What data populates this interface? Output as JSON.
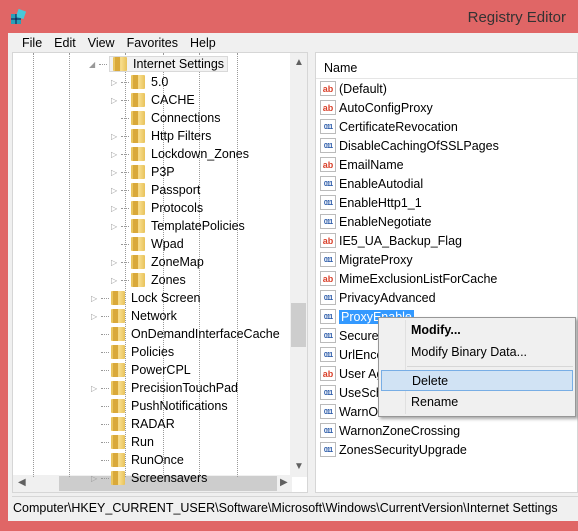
{
  "window": {
    "title": "Registry Editor",
    "icon": "registry-editor-icon",
    "border_color": "#e06666"
  },
  "menu": [
    "File",
    "Edit",
    "View",
    "Favorites",
    "Help"
  ],
  "tree": {
    "selected": "Internet Settings",
    "children": [
      {
        "label": "5.0",
        "expandable": true
      },
      {
        "label": "CACHE",
        "expandable": true
      },
      {
        "label": "Connections",
        "expandable": false
      },
      {
        "label": "Http Filters",
        "expandable": true
      },
      {
        "label": "Lockdown_Zones",
        "expandable": true
      },
      {
        "label": "P3P",
        "expandable": true
      },
      {
        "label": "Passport",
        "expandable": true
      },
      {
        "label": "Protocols",
        "expandable": true
      },
      {
        "label": "TemplatePolicies",
        "expandable": true
      },
      {
        "label": "Wpad",
        "expandable": false
      },
      {
        "label": "ZoneMap",
        "expandable": true
      },
      {
        "label": "Zones",
        "expandable": true
      }
    ],
    "siblings": [
      {
        "label": "Lock Screen",
        "expandable": true
      },
      {
        "label": "Network",
        "expandable": true
      },
      {
        "label": "OnDemandInterfaceCache",
        "expandable": false
      },
      {
        "label": "Policies",
        "expandable": false
      },
      {
        "label": "PowerCPL",
        "expandable": false
      },
      {
        "label": "PrecisionTouchPad",
        "expandable": true
      },
      {
        "label": "PushNotifications",
        "expandable": false
      },
      {
        "label": "RADAR",
        "expandable": false
      },
      {
        "label": "Run",
        "expandable": false
      },
      {
        "label": "RunOnce",
        "expandable": false
      },
      {
        "label": "Screensavers",
        "expandable": true
      }
    ]
  },
  "list": {
    "header": "Name",
    "items": [
      {
        "name": "(Default)",
        "type": "sz"
      },
      {
        "name": "AutoConfigProxy",
        "type": "sz"
      },
      {
        "name": "CertificateRevocation",
        "type": "bin"
      },
      {
        "name": "DisableCachingOfSSLPages",
        "type": "bin"
      },
      {
        "name": "EmailName",
        "type": "sz"
      },
      {
        "name": "EnableAutodial",
        "type": "bin"
      },
      {
        "name": "EnableHttp1_1",
        "type": "bin"
      },
      {
        "name": "EnableNegotiate",
        "type": "bin"
      },
      {
        "name": "IE5_UA_Backup_Flag",
        "type": "sz"
      },
      {
        "name": "MigrateProxy",
        "type": "bin"
      },
      {
        "name": "MimeExclusionListForCache",
        "type": "sz"
      },
      {
        "name": "PrivacyAdvanced",
        "type": "bin"
      },
      {
        "name": "ProxyEnable",
        "type": "bin",
        "selected": true
      },
      {
        "name": "SecureProtocols",
        "type": "bin"
      },
      {
        "name": "UrlEncoding",
        "type": "bin"
      },
      {
        "name": "User Agent",
        "type": "sz"
      },
      {
        "name": "UseSchannelDirectly",
        "type": "bin"
      },
      {
        "name": "WarnOnIntranet",
        "type": "bin"
      },
      {
        "name": "WarnonZoneCrossing",
        "type": "bin"
      },
      {
        "name": "ZonesSecurityUpgrade",
        "type": "bin"
      }
    ]
  },
  "context_menu": {
    "items": [
      {
        "label": "Modify...",
        "bold": true
      },
      {
        "label": "Modify Binary Data..."
      },
      {
        "label": "Delete",
        "highlighted": true
      },
      {
        "label": "Rename"
      }
    ]
  },
  "status_bar": "Computer\\HKEY_CURRENT_USER\\Software\\Microsoft\\Windows\\CurrentVersion\\Internet Settings"
}
